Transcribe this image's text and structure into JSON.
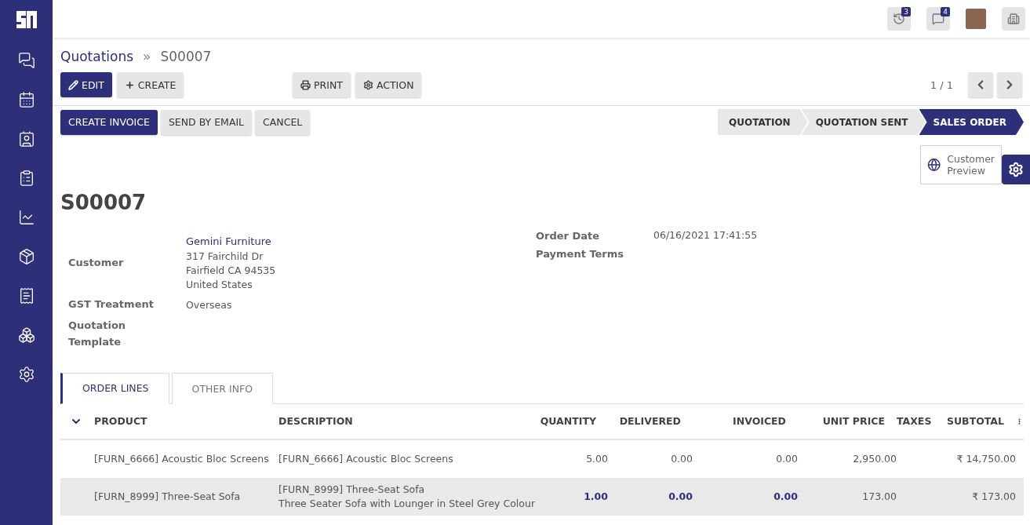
{
  "sidebar": {
    "items": [
      {
        "kind": "chat"
      },
      {
        "kind": "calendar"
      },
      {
        "kind": "contacts"
      },
      {
        "kind": "clipboard"
      },
      {
        "kind": "chart"
      },
      {
        "kind": "box"
      },
      {
        "kind": "invoice"
      },
      {
        "kind": "boxes"
      },
      {
        "kind": "settings"
      }
    ]
  },
  "topbar": {
    "activities_count": "3",
    "messages_count": "4"
  },
  "breadcrumb": {
    "parent": "Quotations",
    "separator": "»",
    "current": "S00007"
  },
  "toolbar": {
    "left": [
      {
        "label": "EDIT",
        "kind": "edit",
        "primary": true
      },
      {
        "label": "CREATE",
        "kind": "create",
        "primary": false
      }
    ],
    "middle": [
      {
        "label": "PRINT",
        "kind": "print"
      },
      {
        "label": "ACTION",
        "kind": "action"
      }
    ],
    "pager": "1 / 1"
  },
  "actions": [
    {
      "label": "CREATE INVOICE",
      "primary": true
    },
    {
      "label": "SEND BY EMAIL",
      "primary": false
    },
    {
      "label": "CANCEL",
      "primary": false
    }
  ],
  "status_steps": [
    {
      "label": "QUOTATION",
      "selected": false
    },
    {
      "label": "QUOTATION SENT",
      "selected": false
    },
    {
      "label": "SALES ORDER",
      "selected": true
    }
  ],
  "smart_button": {
    "label": "Customer\nPreview"
  },
  "record_title": "S00007",
  "left_fields": [
    {
      "label": "Customer",
      "link": "Gemini Furniture",
      "lines": [
        "317 Fairchild Dr",
        "Fairfield CA 94535",
        "United States"
      ]
    },
    {
      "label": "GST Treatment",
      "value": "Overseas"
    },
    {
      "label": "Quotation\nTemplate"
    }
  ],
  "right_fields": [
    {
      "label": "Order Date",
      "value": "06/16/2021 17:41:55"
    },
    {
      "label": "Payment Terms"
    }
  ],
  "tabs": [
    {
      "label": "ORDER LINES",
      "selected": true
    },
    {
      "label": "OTHER INFO",
      "selected": false
    }
  ],
  "table": {
    "columns": [
      {
        "label": "PRODUCT",
        "kind": "text"
      },
      {
        "label": "DESCRIPTION",
        "kind": "text"
      },
      {
        "label": "QUANTITY",
        "kind": "number"
      },
      {
        "label": "DELIVERED",
        "kind": "number"
      },
      {
        "label": "INVOICED",
        "kind": "number"
      },
      {
        "label": "UNIT PRICE",
        "kind": "number"
      },
      {
        "label": "TAXES",
        "kind": "text"
      },
      {
        "label": "SUBTOTAL",
        "kind": "number"
      }
    ],
    "rows": [
      {
        "selected": false,
        "emphasized": false,
        "cells": [
          "[FURN_6666] Acoustic Bloc Screens",
          "[FURN_6666] Acoustic Bloc Screens",
          "5.00",
          "0.00",
          "0.00",
          "2,950.00",
          null,
          "₹ 14,750.00"
        ]
      },
      {
        "selected": true,
        "emphasized": true,
        "cells": [
          "[FURN_8999] Three-Seat Sofa",
          "[FURN_8999] Three-Seat Sofa\nThree Seater Sofa with Lounger in Steel Grey Colour",
          "1.00",
          "0.00",
          "0.00",
          "173.00",
          null,
          "₹ 173.00"
        ]
      }
    ]
  }
}
